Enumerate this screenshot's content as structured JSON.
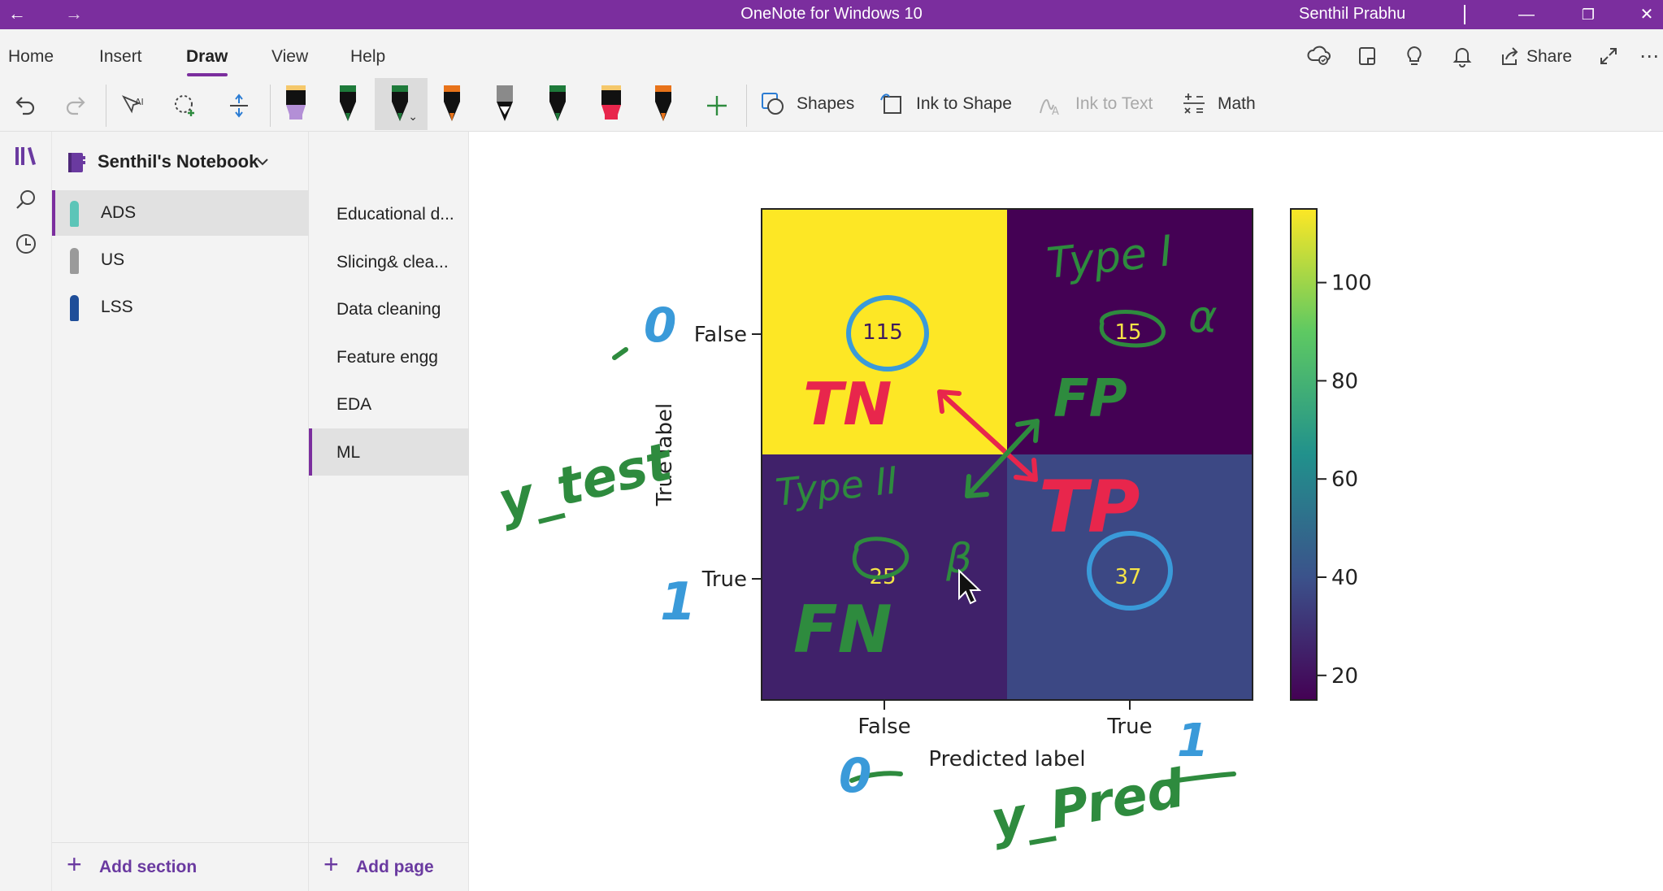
{
  "window": {
    "title": "OneNote for Windows 10",
    "user": "Senthil Prabhu",
    "back_glyph": "←",
    "forward_glyph": "→",
    "minimize_glyph": "—",
    "restore_glyph": "❐",
    "close_glyph": "✕"
  },
  "menu": {
    "tabs": [
      {
        "label": "Home"
      },
      {
        "label": "Insert"
      },
      {
        "label": "Draw"
      },
      {
        "label": "View"
      },
      {
        "label": "Help"
      }
    ],
    "active_tab": "Draw",
    "share_label": "Share",
    "more_glyph": "⋯"
  },
  "ribbon": {
    "shapes_label": "Shapes",
    "ink_to_shape_label": "Ink to Shape",
    "ink_to_text_label": "Ink to Text",
    "math_label": "Math",
    "pens": [
      {
        "icon": "highlighter-icon",
        "color": "#b38fd6"
      },
      {
        "icon": "pen-icon",
        "color": "#1e7a3a"
      },
      {
        "icon": "pen-icon",
        "color": "#1e7a3a"
      },
      {
        "icon": "pen-icon",
        "color": "#e8731a"
      },
      {
        "icon": "pencil-icon",
        "color": "#8a8a8a"
      },
      {
        "icon": "pen-icon",
        "color": "#1e7a3a"
      },
      {
        "icon": "highlighter-icon",
        "color": "#e8264c"
      },
      {
        "icon": "pen-icon",
        "color": "#e8731a"
      }
    ]
  },
  "notebook": {
    "name": "Senthil's Notebook",
    "sections": [
      {
        "label": "ADS",
        "color": "#5cc5b8",
        "selected": true
      },
      {
        "label": "US",
        "color": "#9a9a9a",
        "selected": false
      },
      {
        "label": "LSS",
        "color": "#1f4e99",
        "selected": false
      }
    ],
    "add_section_label": "Add section",
    "pages": [
      {
        "label": "Educational d...",
        "selected": false
      },
      {
        "label": "Slicing& clea...",
        "selected": false
      },
      {
        "label": "Data cleaning",
        "selected": false
      },
      {
        "label": "Feature engg",
        "selected": false
      },
      {
        "label": "EDA",
        "selected": false
      },
      {
        "label": "ML",
        "selected": true
      }
    ],
    "add_page_label": "Add page"
  },
  "confusion_matrix": {
    "cells": [
      [
        115,
        15
      ],
      [
        25,
        37
      ]
    ],
    "row_labels": [
      "False",
      "True"
    ],
    "col_labels": [
      "False",
      "True"
    ],
    "ylabel": "True label",
    "xlabel": "Predicted label",
    "colorbar_ticks": [
      100,
      80,
      60,
      40,
      20
    ],
    "colorbar_range": [
      15,
      115
    ],
    "colors": {
      "high": "#f5e447",
      "low": "#3e1a5e",
      "mid_low": "#3d3f8a",
      "mid": "#44307a"
    }
  },
  "ink_annotations": {
    "tn": "TN",
    "fp": "FP",
    "tp": "TP",
    "fn": "FN",
    "type1": "Type I",
    "type2": "Type II",
    "alpha": "α",
    "beta": "β",
    "y_test": "y_test",
    "y_pred": "y_Pred",
    "zero_left": "0",
    "one_left": "1",
    "zero_bottom": "0",
    "one_bottom": "1",
    "colors": {
      "green": "#2e8b3e",
      "red": "#e8264c",
      "blue": "#3a9ad9"
    }
  }
}
